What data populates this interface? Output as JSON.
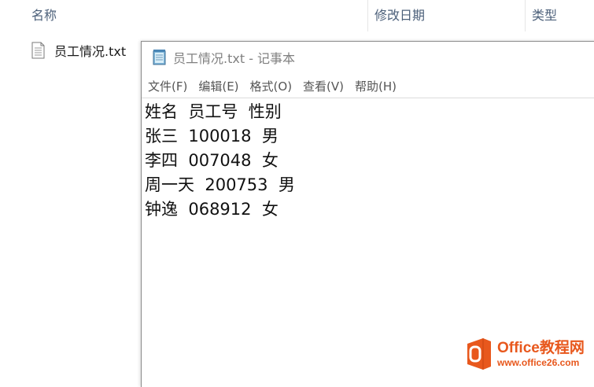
{
  "explorer": {
    "columns": {
      "name": "名称",
      "date": "修改日期",
      "type": "类型"
    },
    "file": {
      "name": "员工情况.txt",
      "icon": "text-file-icon"
    }
  },
  "notepad": {
    "title": "员工情况.txt - 记事本",
    "icon": "notepad-icon",
    "menu": [
      "文件(F)",
      "编辑(E)",
      "格式(O)",
      "查看(V)",
      "帮助(H)"
    ],
    "content_lines": [
      "姓名  员工号  性别",
      "张三  100018  男",
      "李四  007048  女",
      "周一天  200753  男",
      "钟逸  068912  女"
    ]
  },
  "watermark": {
    "brand": "Office教程网",
    "url": "www.office26.com",
    "color": "#e8581d"
  }
}
